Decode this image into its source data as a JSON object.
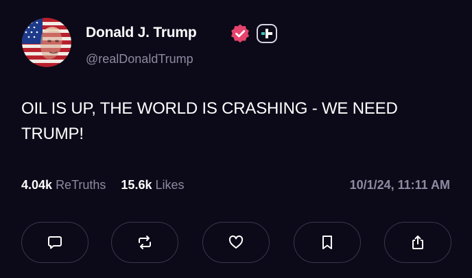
{
  "author": {
    "display_name": "Donald J. Trump",
    "handle": "@realDonaldTrump",
    "verified": true,
    "badge": "plus-badge-icon"
  },
  "post": {
    "text": "OIL IS UP, THE WORLD IS CRASHING - WE NEED TRUMP!",
    "retruths_count": "4.04k",
    "retruths_label": "ReTruths",
    "likes_count": "15.6k",
    "likes_label": "Likes",
    "timestamp": "10/1/24, 11:11 AM"
  },
  "actions": [
    {
      "name": "reply",
      "icon": "comment-icon"
    },
    {
      "name": "retruth",
      "icon": "repost-icon"
    },
    {
      "name": "like",
      "icon": "heart-icon"
    },
    {
      "name": "bookmark",
      "icon": "bookmark-icon"
    },
    {
      "name": "share",
      "icon": "share-icon"
    }
  ],
  "colors": {
    "background": "#0c0a18",
    "text_primary": "#ffffff",
    "text_secondary": "#8e8aa2",
    "verified_badge": "#e5446d",
    "button_border": "#3a3650"
  }
}
